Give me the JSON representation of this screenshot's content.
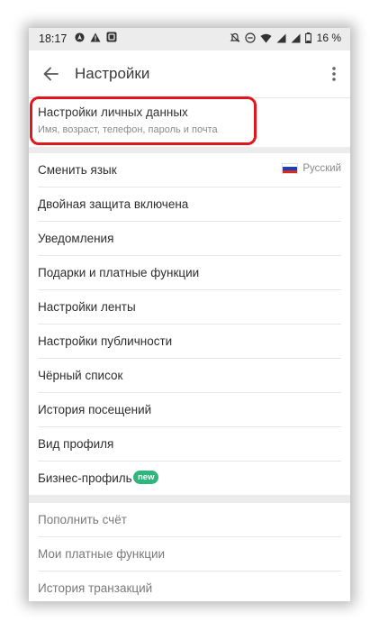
{
  "status_bar": {
    "time": "18:17",
    "battery": "16 %",
    "left_icons": [
      "navigation-icon",
      "warning-icon",
      "app-icon"
    ],
    "right_icons": [
      "notifications-off-icon",
      "dnd-icon",
      "wifi-icon",
      "signal-icon",
      "signal-icon",
      "battery-icon"
    ]
  },
  "app_bar": {
    "title": "Настройки"
  },
  "personal_data": {
    "title": "Настройки личных данных",
    "subtitle": "Имя, возраст, телефон, пароль и почта",
    "highlight_color": "#e0171d"
  },
  "settings_items": [
    {
      "label": "Сменить язык",
      "value": "Русский"
    },
    {
      "label": "Двойная защита включена"
    },
    {
      "label": "Уведомления"
    },
    {
      "label": "Подарки и платные функции"
    },
    {
      "label": "Настройки ленты"
    },
    {
      "label": "Настройки публичности"
    },
    {
      "label": "Чёрный список"
    },
    {
      "label": "История посещений"
    },
    {
      "label": "Вид профиля"
    },
    {
      "label": "Бизнес-профиль",
      "badge": "new"
    }
  ],
  "payment_items": [
    {
      "label": "Пополнить счёт"
    },
    {
      "label": "Мои платные функции"
    },
    {
      "label": "История транзакций"
    }
  ],
  "colors": {
    "accent_badge": "#2eb67d",
    "section_band": "#ececec"
  }
}
